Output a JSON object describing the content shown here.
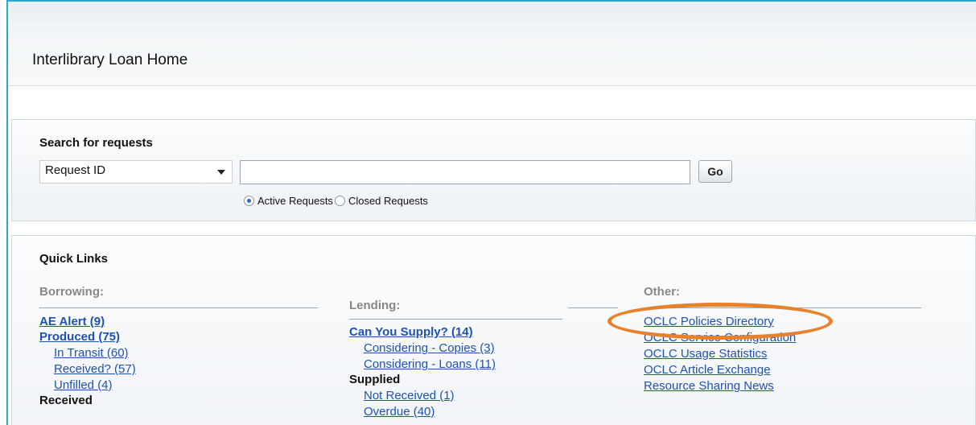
{
  "page": {
    "title": "Interlibrary Loan Home"
  },
  "search": {
    "heading": "Search for requests",
    "select_value": "Request ID",
    "input_value": "",
    "go_label": "Go",
    "radio_active": "Active Requests",
    "radio_closed": "Closed Requests",
    "selected_radio": "Active Requests"
  },
  "quick_links": {
    "heading": "Quick Links",
    "borrowing": {
      "heading": "Borrowing:",
      "items": [
        "AE Alert (9)",
        "Produced (75)",
        "In Transit (60)",
        "Received? (57)",
        "Unfilled (4)"
      ],
      "received_label": "Received"
    },
    "lending": {
      "heading": "Lending:",
      "can_you_supply": "Can You Supply? (14)",
      "considering_copies": "Considering - Copies (3)",
      "considering_loans": "Considering - Loans (11)",
      "supplied_label": "Supplied",
      "not_received": "Not Received (1)",
      "overdue": "Overdue (40)"
    },
    "other": {
      "heading": "Other:",
      "items": [
        "OCLC Policies Directory",
        "OCLC Service Configuration",
        "OCLC Usage Statistics",
        "OCLC Article Exchange",
        "Resource Sharing News"
      ]
    }
  },
  "colors": {
    "link": "#1f52b0",
    "highlight": "#e8812b",
    "frame_border": "#2aa7c9"
  }
}
